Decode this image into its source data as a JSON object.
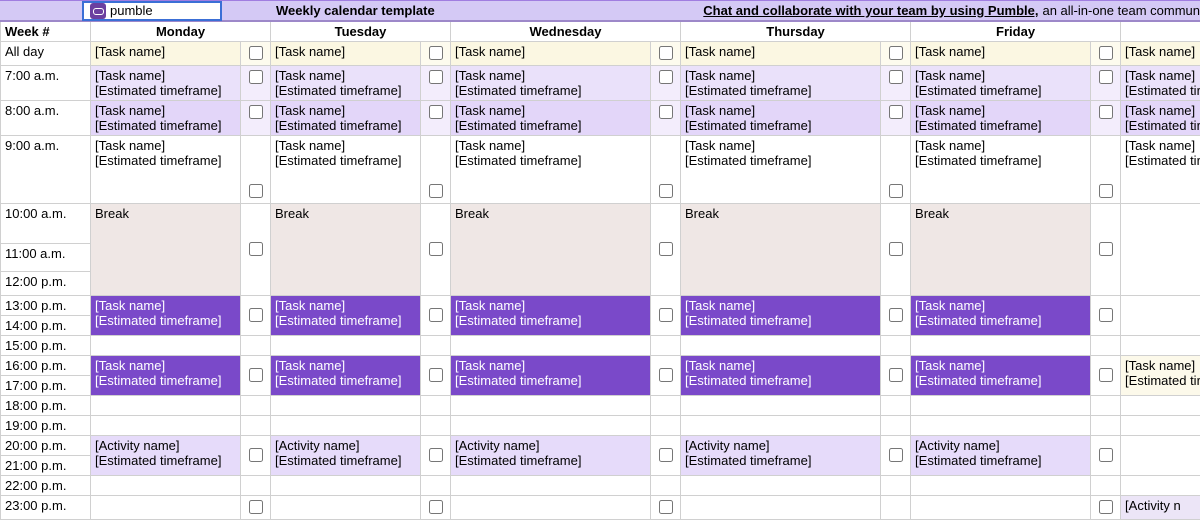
{
  "banner": {
    "logo_text": "pumble",
    "title": "Weekly calendar template",
    "link": "Chat and collaborate with your team by using Pumble,",
    "tail": " an all-in-one team commun"
  },
  "headers": {
    "week": "Week #",
    "mon": "Monday",
    "tue": "Tuesday",
    "wed": "Wednesday",
    "thu": "Thursday",
    "fri": "Friday"
  },
  "times": {
    "allday": "All day",
    "t7": "7:00 a.m.",
    "t8": "8:00 a.m.",
    "t9": "9:00 a.m.",
    "t10": "10:00 a.m.",
    "t11": "11:00 a.m.",
    "t12": "12:00 p.m.",
    "t13": "13:00 p.m.",
    "t14": "14:00 p.m.",
    "t15": "15:00 p.m.",
    "t16": "16:00 p.m.",
    "t17": "17:00 p.m.",
    "t18": "18:00 p.m.",
    "t19": "19:00 p.m.",
    "t20": "20:00 p.m.",
    "t21": "21:00 p.m.",
    "t22": "22:00 p.m.",
    "t23": "23:00 p.m."
  },
  "labels": {
    "task": "[Task name]",
    "timeframe": "[Estimated timeframe]",
    "timeframe_cut": "[Estimated tir",
    "break": "Break",
    "activity": "[Activity name]",
    "activity_short": "[Activity n"
  }
}
